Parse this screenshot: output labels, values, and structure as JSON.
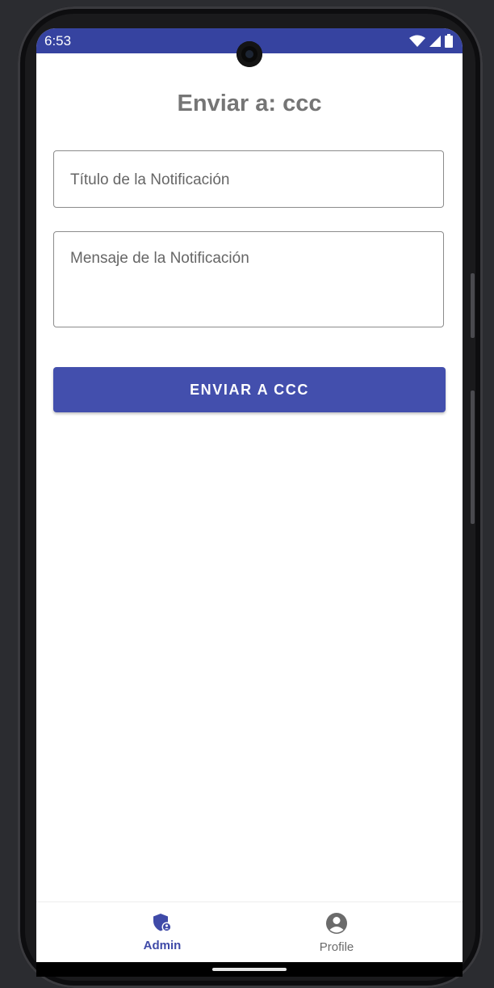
{
  "status_bar": {
    "time": "6:53",
    "background_color": "#3643a0",
    "icons": [
      "wifi-icon",
      "signal-icon",
      "battery-icon"
    ]
  },
  "page": {
    "title": "Enviar a: ccc"
  },
  "form": {
    "title_placeholder": "Título de la Notificación",
    "message_placeholder": "Mensaje de la Notificación",
    "send_button_label": "ENVIAR A CCC",
    "button_color": "#434fad"
  },
  "bottom_nav": {
    "items": [
      {
        "label": "Admin",
        "icon": "admin-shield-icon",
        "active": true
      },
      {
        "label": "Profile",
        "icon": "profile-icon",
        "active": false
      }
    ],
    "active_color": "#3f4aa8",
    "inactive_color": "#6b6b6b"
  }
}
